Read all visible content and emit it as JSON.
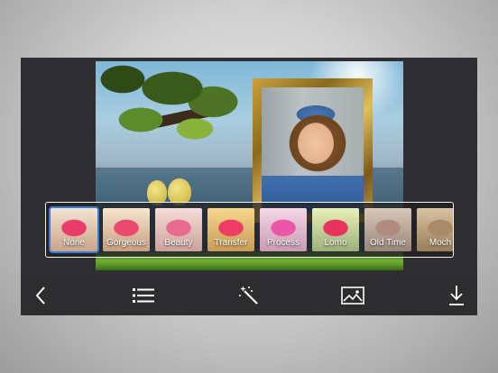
{
  "filters": [
    {
      "label": "None",
      "selected": true,
      "top": "#f3e4d2",
      "bottom": "#c9a58a",
      "petal": "#e83d6a"
    },
    {
      "label": "Gorgeous",
      "selected": false,
      "top": "#f6e6cf",
      "bottom": "#c79f7f",
      "petal": "#ea4a6f"
    },
    {
      "label": "Beauty",
      "selected": false,
      "top": "#f6dcd8",
      "bottom": "#cca29a",
      "petal": "#e86a8e"
    },
    {
      "label": "Transfer",
      "selected": false,
      "top": "#f7d98e",
      "bottom": "#c99a55",
      "petal": "#ef3c64"
    },
    {
      "label": "Process",
      "selected": false,
      "top": "#f5d7e6",
      "bottom": "#c99bb3",
      "petal": "#e957a6"
    },
    {
      "label": "Lomo",
      "selected": false,
      "top": "#e8f0b8",
      "bottom": "#9db07a",
      "petal": "#e8335f"
    },
    {
      "label": "Old Time",
      "selected": false,
      "top": "#d8c8bc",
      "bottom": "#9a8579",
      "petal": "#b08c80"
    },
    {
      "label": "Moch",
      "selected": false,
      "top": "#d8c2a2",
      "bottom": "#9b7e5b",
      "petal": "#a98a6a"
    }
  ],
  "toolbar": {
    "icons": [
      "back-chevron-icon",
      "list-icon",
      "magic-wand-icon",
      "image-icon",
      "download-icon"
    ]
  }
}
